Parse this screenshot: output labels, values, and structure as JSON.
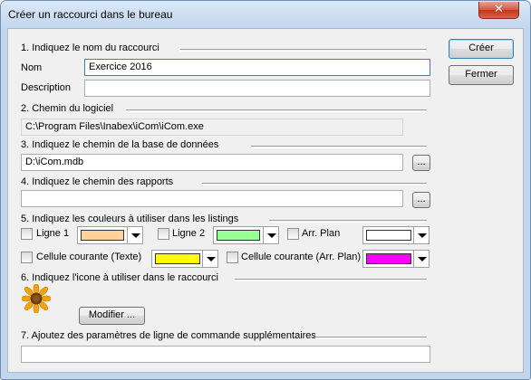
{
  "window": {
    "title": "Créer un raccourci dans le bureau",
    "close_symbol": "✕"
  },
  "sections": {
    "s1": "1. Indiquez le nom du raccourci",
    "s2": "2. Chemin du logiciel",
    "s3": "3. Indiquez le chemin de la base de données",
    "s4": "4. Indiquez le chemin des rapports",
    "s5": "5. Indiquez les couleurs à utiliser dans les listings",
    "s6": "6. Indiquez l'icone à utiliser dans le raccourci",
    "s7": "7. Ajoutez des paramètres de ligne de commande supplémentaires"
  },
  "fields": {
    "nom_label": "Nom",
    "nom_value": "Exercice 2016",
    "description_label": "Description",
    "description_value": "",
    "software_path": "C:\\Program Files\\Inabex\\iCom\\iCom.exe",
    "db_path": "D:\\iCom.mdb",
    "reports_path": "",
    "cmd_params": ""
  },
  "colors": {
    "ligne1": {
      "label": "Ligne 1",
      "checked": false,
      "color": "#ffd39b"
    },
    "ligne2": {
      "label": "Ligne 2",
      "checked": false,
      "color": "#99ff99"
    },
    "arr_plan": {
      "label": "Arr. Plan",
      "checked": false,
      "color": "#ffffff"
    },
    "cell_texte": {
      "label": "Cellule courante (Texte)",
      "checked": false,
      "color": "#ffff00"
    },
    "cell_arr_plan": {
      "label": "Cellule courante (Arr. Plan)",
      "checked": false,
      "color": "#ff00ff"
    }
  },
  "buttons": {
    "creer": "Créer",
    "fermer": "Fermer",
    "browse": "...",
    "modifier": "Modifier ..."
  },
  "icon": {
    "name": "sunflower-icon"
  }
}
